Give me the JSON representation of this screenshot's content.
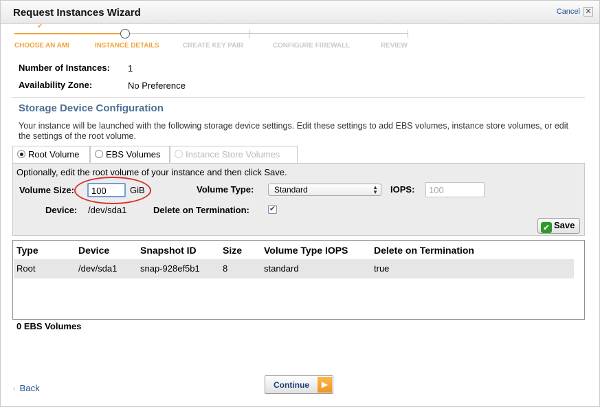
{
  "window": {
    "title": "Request Instances Wizard",
    "cancel_label": "Cancel",
    "close_glyph": "✕"
  },
  "steps": [
    {
      "label": "CHOOSE AN AMI",
      "state": "done"
    },
    {
      "label": "INSTANCE DETAILS",
      "state": "current"
    },
    {
      "label": "CREATE KEY PAIR",
      "state": "future"
    },
    {
      "label": "CONFIGURE FIREWALL",
      "state": "future"
    },
    {
      "label": "REVIEW",
      "state": "future"
    }
  ],
  "summary": {
    "instances_label": "Number of Instances:",
    "instances_value": "1",
    "zone_label": "Availability Zone:",
    "zone_value": "No Preference"
  },
  "storage": {
    "title": "Storage Device Configuration",
    "description": "Your instance will be launched with the following storage device settings. Edit these settings to add EBS volumes, instance store volumes, or edit the settings of the root volume.",
    "tabs": [
      {
        "label": "Root Volume",
        "selected": true,
        "enabled": true
      },
      {
        "label": "EBS Volumes",
        "selected": false,
        "enabled": true
      },
      {
        "label": "Instance Store Volumes",
        "selected": false,
        "enabled": false
      }
    ],
    "hint": "Optionally, edit the root volume of your instance and then click Save.",
    "volume_size_label": "Volume Size:",
    "volume_size_value": "100",
    "volume_size_unit": "GiB",
    "volume_type_label": "Volume Type:",
    "volume_type_value": "Standard",
    "iops_label": "IOPS:",
    "iops_placeholder": "100",
    "device_label": "Device:",
    "device_value": "/dev/sda1",
    "delete_label": "Delete on Termination:",
    "delete_checked": true,
    "save_label": "Save"
  },
  "table": {
    "headers": [
      "Type",
      "Device",
      "Snapshot ID",
      "Size",
      "Volume Type IOPS",
      "Delete on Termination"
    ],
    "rows": [
      [
        "Root",
        "/dev/sda1",
        "snap-928ef5b1",
        "8",
        "standard",
        "true"
      ]
    ]
  },
  "ebs_count": "0 EBS Volumes",
  "footer": {
    "back_label": "Back",
    "continue_label": "Continue"
  },
  "colors": {
    "accent": "#f1a33d",
    "link": "#1a4e95",
    "section_title": "#4d7096",
    "highlight": "#d9332d"
  }
}
